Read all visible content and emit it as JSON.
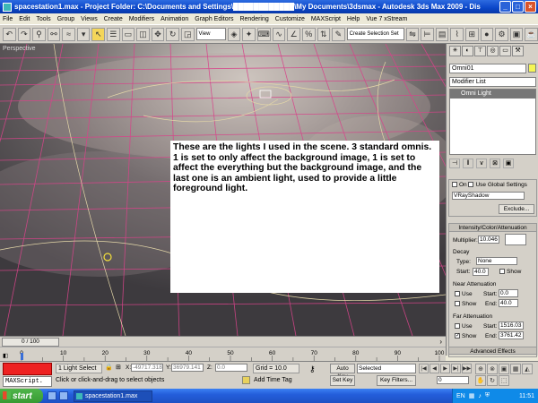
{
  "window": {
    "title": "spacestation1.max    - Project Folder: C:\\Documents and Settings\\████████████\\My Documents\\3dsmax    - Autodesk 3ds Max  2009    - Dis..."
  },
  "menu": [
    "File",
    "Edit",
    "Tools",
    "Group",
    "Views",
    "Create",
    "Modifiers",
    "Animation",
    "Graph Editors",
    "Rendering",
    "Customize",
    "MAXScript",
    "Help",
    "Vue 7 xStream"
  ],
  "toolbar": {
    "view_dropdown": "View",
    "selection_set": "Create Selection Set"
  },
  "viewport": {
    "label": "Perspective",
    "note": "These are the lights I used in the scene. 3 standard omnis.   1 is set to only affect the background image, 1 is set to affect the everything but the background image, and the last one is an ambient light, used to provide a little foreground light."
  },
  "command_panel": {
    "object_name": "Omni01",
    "object_color": "#f5f556",
    "modifier_list": "Modifier List",
    "stack_item": "Omni Light",
    "shadows": {
      "on_label": "On",
      "global_label": "Use Global Settings",
      "type": "VRayShadow",
      "exclude_label": "Exclude..."
    },
    "intensity": {
      "header": "Intensity/Color/Attenuation",
      "multiplier_label": "Multiplier:",
      "multiplier": "10.046",
      "decay_label": "Decay",
      "type_label": "Type:",
      "type": "None",
      "start_label": "Start:",
      "start": "40.0",
      "show_label": "Show"
    },
    "near_atten": {
      "header": "Near Attenuation",
      "use_label": "Use",
      "show_label": "Show",
      "start_label": "Start:",
      "start": "0.0",
      "end_label": "End:",
      "end": "40.0"
    },
    "far_atten": {
      "header": "Far Attenuation",
      "use_label": "Use",
      "show_label": "Show",
      "start_label": "Start:",
      "start": "1516.03",
      "end_label": "End:",
      "end": "3761.42"
    },
    "advanced": "Advanced Effects"
  },
  "timeline": {
    "slider": "0 / 100",
    "ticks": [
      "0",
      "10",
      "20",
      "30",
      "40",
      "50",
      "60",
      "70",
      "80",
      "90",
      "100"
    ]
  },
  "status": {
    "selection": "1 Light Select",
    "x_label": "X:",
    "x": "-49717.318",
    "y_label": "Y:",
    "y": "36979.141",
    "z_label": "Z:",
    "z": "0.0",
    "grid": "Grid = 10.0",
    "autokey": "Auto Key",
    "selected": "Selected",
    "setkey": "Set Key",
    "keyfilters": "Key Filters...",
    "frame": "0",
    "maxscript": "MAXScript.",
    "prompt": "Click or click-and-drag to select objects",
    "addtimetag": "Add Time Tag"
  },
  "taskbar": {
    "start": "start",
    "item": "spacestation1.max",
    "lang": "EN",
    "clock": "11:51"
  }
}
